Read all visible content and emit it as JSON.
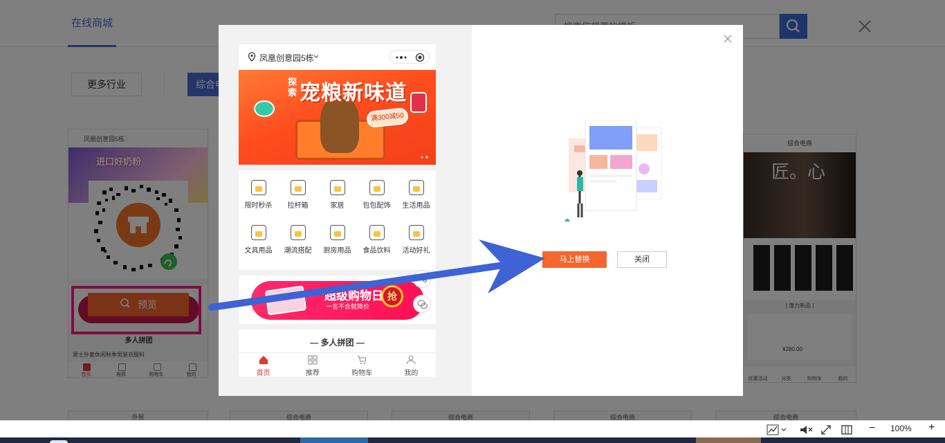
{
  "nav": {
    "active_tab": "在线商城"
  },
  "search": {
    "placeholder": "搜索您想要的模板"
  },
  "filters": {
    "more_label": "更多行业",
    "category_label": "综合电商"
  },
  "template_card": {
    "location": "凤凰创意园5栋",
    "banner_text": "进口好奶粉",
    "group_title": "多人拼团",
    "product_line": "男士外套休闲秋季男装衣服料",
    "nav": [
      "首页",
      "推荐",
      "购物车",
      "我的"
    ]
  },
  "preview_button": {
    "label": "预览"
  },
  "right_card": {
    "title": "综合电商",
    "banner_text": "匠。心",
    "section": "| 潜力新品 |",
    "price": "¥280.00",
    "nav": [
      "优惠活动",
      "分类",
      "购物车",
      "我的"
    ]
  },
  "bottom_cards": [
    "外贸",
    "综合电商",
    "综合电商",
    "综合电商",
    "综合电商"
  ],
  "modal": {
    "phone": {
      "location": "凤凰创意园5栋",
      "banner_kicker": "探索",
      "banner_title": "宠粮新味道",
      "banner_badge": "满300减50",
      "icons": [
        "限时秒杀",
        "拉杆箱",
        "家居",
        "包包配饰",
        "生活用品",
        "文具用品",
        "潮流搭配",
        "厨房用品",
        "食品饮料",
        "活动好礼"
      ],
      "promo_title": "超级购物日",
      "promo_sub": "一言不合就降价",
      "promo_grab": "抢",
      "group_title": "— 多人拼团 —",
      "nav": [
        "首页",
        "推荐",
        "购物车",
        "我的"
      ]
    },
    "replace_label": "马上替换",
    "close_label": "关闭"
  },
  "statusbar": {
    "zoom": "100%"
  },
  "colors": {
    "accent_blue": "#4a6ad4",
    "orange": "#f4662d",
    "highlight_pink": "#ff1a7b",
    "arrow_blue": "#3d63d4"
  }
}
